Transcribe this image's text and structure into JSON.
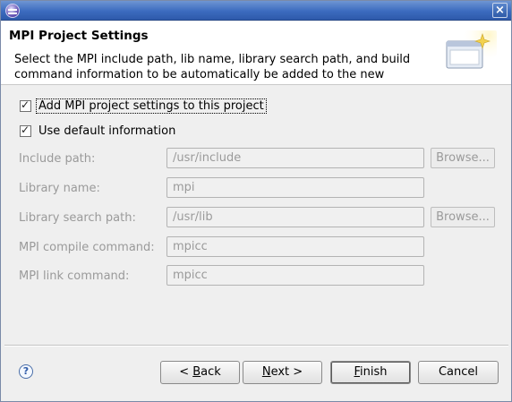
{
  "window": {
    "app_icon": "eclipse-icon",
    "close_icon": "close-icon",
    "close_glyph": "×"
  },
  "header": {
    "title": "MPI Project Settings",
    "description": "Select the MPI include path, lib name, library search path, and build command information to be automatically be added to the new",
    "banner_icon": "wizard-banner-icon"
  },
  "options": {
    "add_settings": {
      "label": "Add MPI project settings to this project",
      "checked": true
    },
    "use_default": {
      "label": "Use default information",
      "checked": true
    }
  },
  "fields": [
    {
      "label": "Include path:",
      "value": "/usr/include",
      "has_browse": true
    },
    {
      "label": "Library name:",
      "value": "mpi",
      "has_browse": false
    },
    {
      "label": "Library search path:",
      "value": "/usr/lib",
      "has_browse": true
    },
    {
      "label": "MPI compile command:",
      "value": "mpicc",
      "has_browse": false
    },
    {
      "label": "MPI link command:",
      "value": "mpicc",
      "has_browse": false
    }
  ],
  "browse_label": "Browse...",
  "footer": {
    "help_glyph": "?",
    "back_mnemonic": "B",
    "back_rest": "ack",
    "back_prefix": "< ",
    "next_mnemonic": "N",
    "next_rest": "ext >",
    "finish_mnemonic": "F",
    "finish_rest": "inish",
    "cancel_label": "Cancel"
  }
}
